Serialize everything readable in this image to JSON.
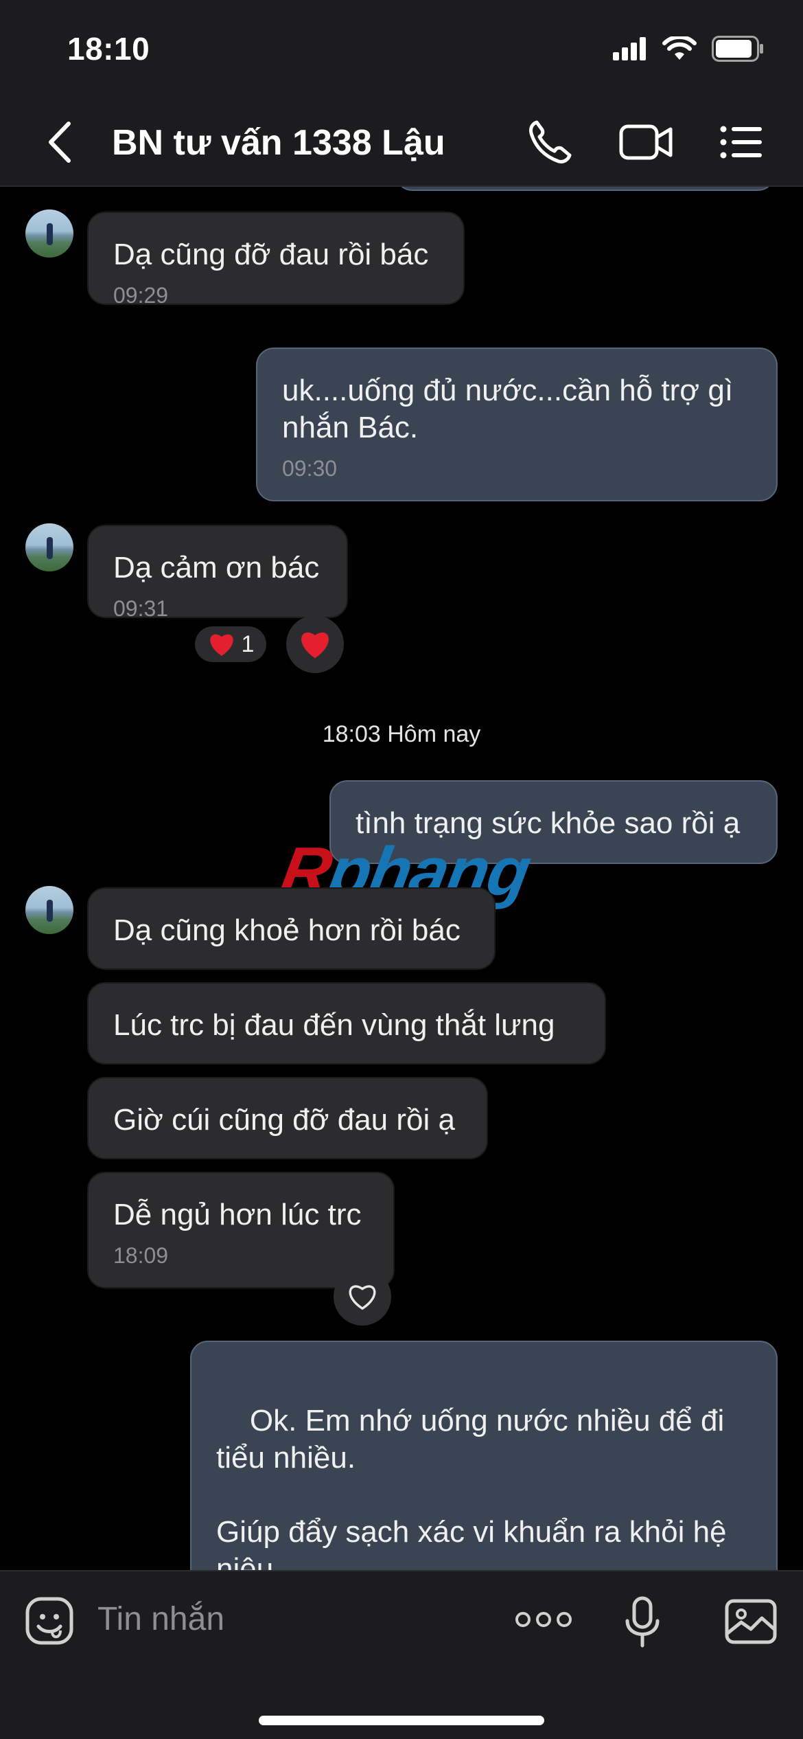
{
  "status_bar": {
    "time": "18:10",
    "battery_level": 0.9
  },
  "header": {
    "title": "BN tư vấn 1338 Lậu",
    "icons": [
      "chevron-left-icon",
      "phone-icon",
      "video-camera-icon",
      "list-menu-icon"
    ]
  },
  "messages": [
    {
      "direction": "in",
      "text": "Dạ cũng đỡ đau rồi bác",
      "time": "09:29"
    },
    {
      "direction": "out",
      "text": "uk....uống đủ nước...cần hỗ trợ gì nhắn Bác.",
      "time": "09:30"
    },
    {
      "direction": "in",
      "text": "Dạ cảm ơn bác",
      "time": "09:31",
      "reaction": {
        "emoji": "❤️",
        "count": "1"
      }
    },
    {
      "direction": "out",
      "text": "tình trạng sức khỏe sao rồi ạ"
    },
    {
      "direction": "in",
      "text": "Dạ cũng khoẻ hơn rồi bác"
    },
    {
      "direction": "in",
      "text": "Lúc trc bị đau đến vùng thắt lưng"
    },
    {
      "direction": "in",
      "text": "Giờ cúi cũng đỡ đau rồi ạ"
    },
    {
      "direction": "in",
      "text": "Dễ ngủ hơn lúc trc",
      "time": "18:09"
    },
    {
      "direction": "out",
      "text": "Ok. Em nhớ uống nước nhiều để đi tiểu nhiều.\n\nGiúp đẩy sạch xác vi khuẩn ra khỏi hệ niệu"
    }
  ],
  "date_separator": "18:03 Hôm nay",
  "watermark": {
    "first": "R",
    "rest": "phang"
  },
  "input": {
    "placeholder": "Tin nhắn"
  },
  "colors": {
    "incoming_bubble": "#2c2c2e",
    "outgoing_bubble": "#3a4453",
    "background": "#000000",
    "bar": "#1c1c1e"
  }
}
